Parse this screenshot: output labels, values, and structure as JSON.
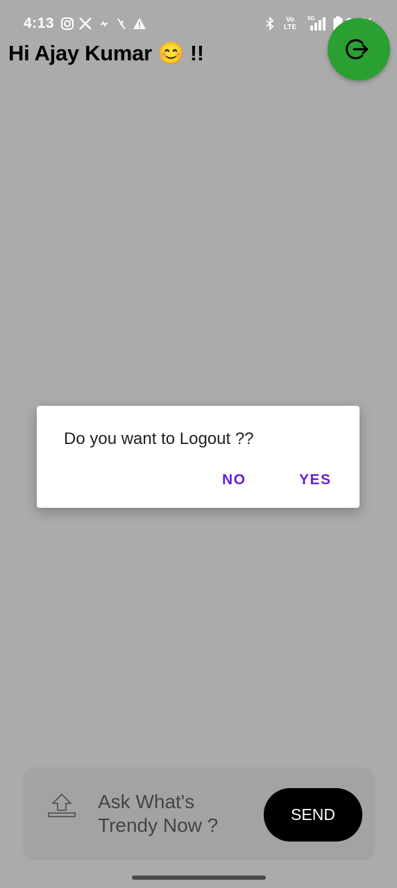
{
  "status_bar": {
    "time": "4:13",
    "battery": "98%",
    "left_icons": [
      "instagram-icon",
      "x-icon",
      "notification-icon",
      "notification-icon",
      "warning-icon"
    ],
    "right_icons": [
      "bluetooth-icon",
      "volte-icon",
      "signal-5g-icon",
      "battery-icon"
    ],
    "volte_top": "Vo",
    "volte_bottom": "LTE",
    "network": "5G"
  },
  "header": {
    "greeting": "Hi Ajay Kumar 😊 !!",
    "logout_icon": "logout-icon",
    "fab_color": "#2aa033"
  },
  "dialog": {
    "message": "Do you want to Logout ??",
    "no_label": "NO",
    "yes_label": "YES",
    "accent_color": "#6a1fd1"
  },
  "composer": {
    "placeholder": "Ask What's Trendy Now ?",
    "send_label": "SEND",
    "upload_icon": "upload-icon"
  },
  "colors": {
    "scrim_background": "#ababab",
    "send_button": "#000000"
  }
}
